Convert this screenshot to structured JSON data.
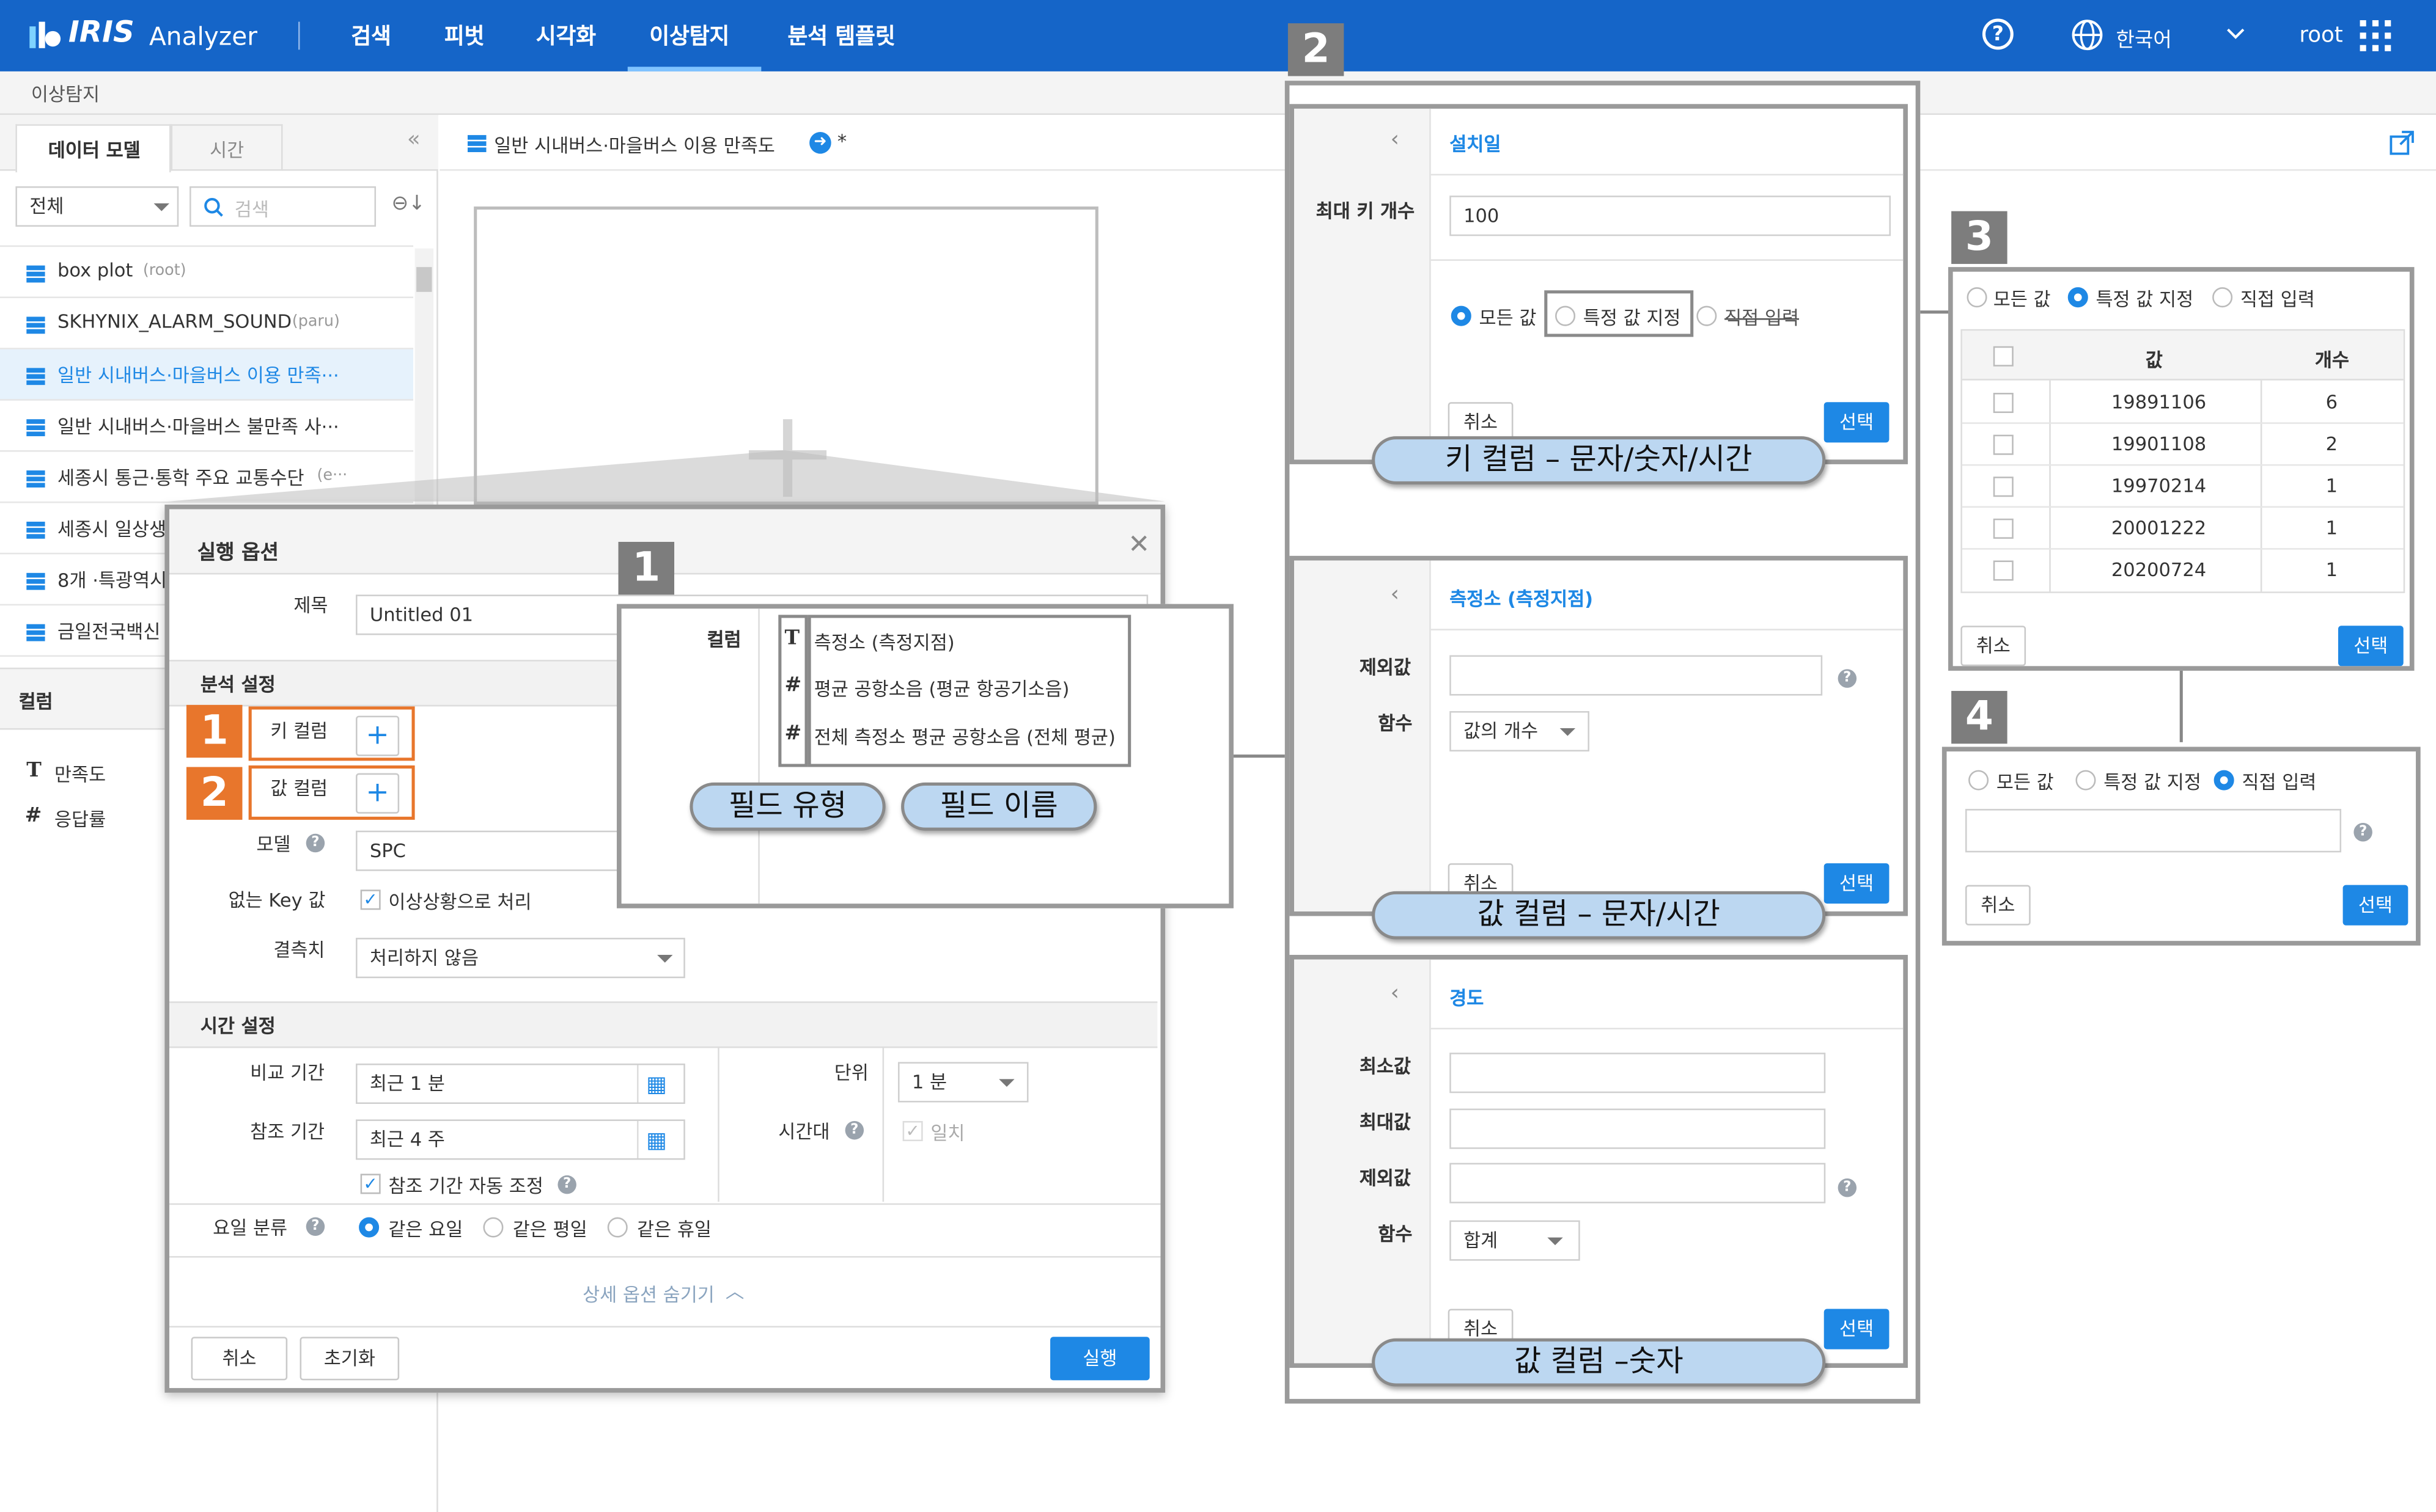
{
  "header": {
    "logo": "IRIS",
    "app_name": "Analyzer",
    "nav": [
      "검색",
      "피벗",
      "시각화",
      "이상탐지",
      "분석 템플릿"
    ],
    "active_nav": "이상탐지",
    "language": "한국어",
    "user": "root"
  },
  "breadcrumb": "이상탐지",
  "sidebar": {
    "tabs": [
      "데이터 모델",
      "시간"
    ],
    "filter_value": "전체",
    "search_placeholder": "검색",
    "items": [
      {
        "label": "box plot",
        "owner": "(root)"
      },
      {
        "label": "SKHYNIX_ALARM_SOUND",
        "owner": "(paru)"
      },
      {
        "label": "일반 시내버스·마을버스 이용 만족···",
        "owner": ""
      },
      {
        "label": "일반 시내버스·마을버스 불만족 사···",
        "owner": ""
      },
      {
        "label": "세종시 통근·통학 주요 교통수단",
        "owner": "(e···"
      },
      {
        "label": "세종시 일상생",
        "owner": ""
      },
      {
        "label": "8개 ·특광역시",
        "owner": ""
      },
      {
        "label": "금일전국백신",
        "owner": ""
      }
    ],
    "column_header": "컬럼",
    "columns": [
      {
        "type": "T",
        "name": "만족도"
      },
      {
        "type": "#",
        "name": "응답률"
      }
    ]
  },
  "toolbar": {
    "model_title": "일반 시내버스·마을버스 이용 만족도",
    "modified_mark": "*"
  },
  "dialog": {
    "title": "실행 옵션",
    "title_label": "제목",
    "title_value": "Untitled 01",
    "analysis_section": "분석 설정",
    "key_column_label": "키 컬럼",
    "value_column_label": "값 컬럼",
    "model_label": "모델",
    "model_value": "SPC",
    "missing_key_label": "없는 Key 값",
    "missing_key_option": "이상상황으로 처리",
    "missing_value_label": "결측치",
    "missing_value_option": "처리하지 않음",
    "time_section": "시간 설정",
    "compare_period_label": "비교 기간",
    "compare_period_value": "최근 1 분",
    "ref_period_label": "참조 기간",
    "ref_period_value": "최근 4 주",
    "auto_adjust": "참조 기간 자동 조정",
    "unit_label": "단위",
    "unit_value": "1 분",
    "timezone_label": "시간대",
    "timezone_option": "일치",
    "weekday_label": "요일 분류",
    "weekday_options": [
      "같은 요일",
      "같은 평일",
      "같은 휴일"
    ],
    "hide_detail": "상세 옵션 숨기기",
    "cancel": "취소",
    "reset": "초기화",
    "run": "실행"
  },
  "badges": {
    "one": "1",
    "two": "2",
    "three": "3",
    "four": "4"
  },
  "column_popup": {
    "label": "컬럼",
    "fields": [
      {
        "type": "T",
        "name": "측정소 (측정지점)"
      },
      {
        "type": "#",
        "name": "평균 공항소음 (평균 항공기소음)"
      },
      {
        "type": "#",
        "name": "전체 측정소 평균 공항소음 (전체 평균)"
      }
    ],
    "field_type_pill": "필드 유형",
    "field_name_pill": "필드 이름"
  },
  "panel_key": {
    "field": "설치일",
    "max_keys_label": "최대 키 개수",
    "max_keys_value": "100",
    "radios": [
      "모든 값",
      "특정 값 지정",
      "직접 입력"
    ],
    "cancel": "취소",
    "select": "선택",
    "caption": "키 컬럼 – 문자/숫자/시간"
  },
  "panel_value_text": {
    "field": "측정소 (측정지점)",
    "exclude_label": "제외값",
    "func_label": "함수",
    "func_value": "값의 개수",
    "cancel": "취소",
    "select": "선택",
    "caption": "값 컬럼 – 문자/시간"
  },
  "panel_value_num": {
    "field": "경도",
    "min_label": "최소값",
    "max_label": "최대값",
    "exclude_label": "제외값",
    "func_label": "함수",
    "func_value": "합계",
    "cancel": "취소",
    "select": "선택",
    "caption": "값 컬럼 –숫자"
  },
  "panel_specific": {
    "radios": [
      "모든 값",
      "특정 값 지정",
      "직접 입력"
    ],
    "col_value": "값",
    "col_count": "개수",
    "rows": [
      {
        "value": "19891106",
        "count": "6"
      },
      {
        "value": "19901108",
        "count": "2"
      },
      {
        "value": "19970214",
        "count": "1"
      },
      {
        "value": "20001222",
        "count": "1"
      },
      {
        "value": "20200724",
        "count": "1"
      }
    ],
    "cancel": "취소",
    "select": "선택"
  },
  "panel_direct": {
    "radios": [
      "모든 값",
      "특정 값 지정",
      "직접 입력"
    ],
    "cancel": "취소",
    "select": "선택"
  },
  "colors": {
    "header_bg": "#1565c8",
    "accent": "#1e88e5",
    "callout": "#e8762c",
    "pill": "#bcd7f1"
  }
}
